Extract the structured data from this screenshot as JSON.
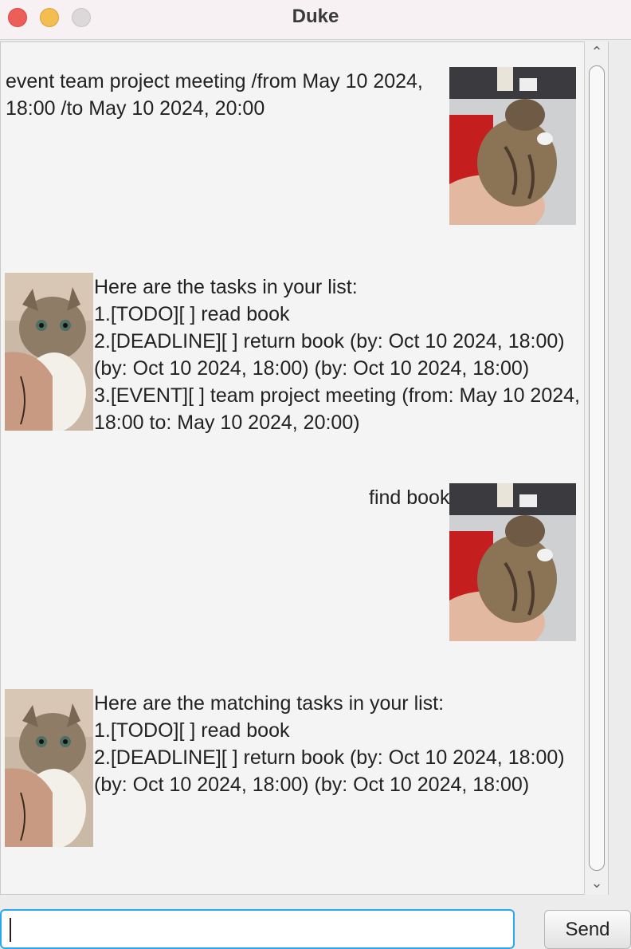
{
  "window": {
    "title": "Duke"
  },
  "messages": [
    {
      "sender": "user",
      "text": "event team project meeting /from May 10 2024,\n18:00 /to May 10 2024, 20:00"
    },
    {
      "sender": "duke",
      "text": "Here are the tasks in your list:\n1.[TODO][ ] read book\n2.[DEADLINE][ ] return book (by: Oct 10 2024, 18:00)\n(by: Oct 10 2024, 18:00) (by: Oct 10 2024, 18:00)\n3.[EVENT][ ] team project meeting (from: May 10 2024,\n18:00 to: May 10 2024, 20:00)"
    },
    {
      "sender": "user",
      "text": "find book"
    },
    {
      "sender": "duke",
      "text": "Here are the matching tasks in your list:\n1.[TODO][ ] read book\n2.[DEADLINE][ ] return book (by: Oct 10 2024, 18:00)\n(by: Oct 10 2024, 18:00) (by: Oct 10 2024, 18:00)"
    }
  ],
  "input": {
    "value": "",
    "placeholder": ""
  },
  "send_label": "Send",
  "colors": {
    "focus_ring": "#2aa7f0",
    "close": "#ec5f58",
    "minimize": "#f4bd4f"
  }
}
